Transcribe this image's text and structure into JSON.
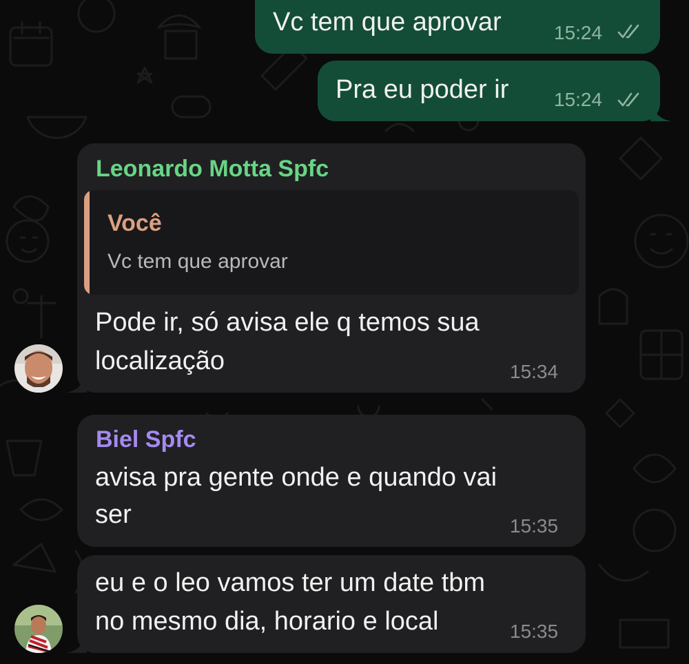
{
  "chat": {
    "messages": [
      {
        "direction": "outgoing",
        "text": "Vc tem que aprovar",
        "time": "15:24",
        "status": "read-double-check-icon"
      },
      {
        "direction": "outgoing",
        "text": "Pra eu poder ir",
        "time": "15:24",
        "status": "read-double-check-icon"
      },
      {
        "direction": "incoming",
        "sender": "Leonardo Motta Spfc",
        "sender_color": "#68d585",
        "quote": {
          "author": "Você",
          "text": "Vc tem que aprovar",
          "accent_color": "#dba082"
        },
        "lines": [
          "Pode ir, só avisa ele q temos sua",
          "localização"
        ],
        "time": "15:34"
      },
      {
        "direction": "incoming",
        "sender": "Biel Spfc",
        "sender_color": "#a48af0",
        "lines": [
          "avisa pra gente onde e quando vai",
          "ser"
        ],
        "time": "15:35"
      },
      {
        "direction": "incoming",
        "lines": [
          "eu e o leo vamos ter um date tbm",
          "no mesmo dia, horario e local"
        ],
        "time": "15:35"
      }
    ]
  },
  "colors": {
    "background": "#0b0b0b",
    "outgoing_bubble": "#144d37",
    "incoming_bubble": "#202022",
    "text": "#f1f1f1",
    "timestamp": "#8b8b8e"
  }
}
